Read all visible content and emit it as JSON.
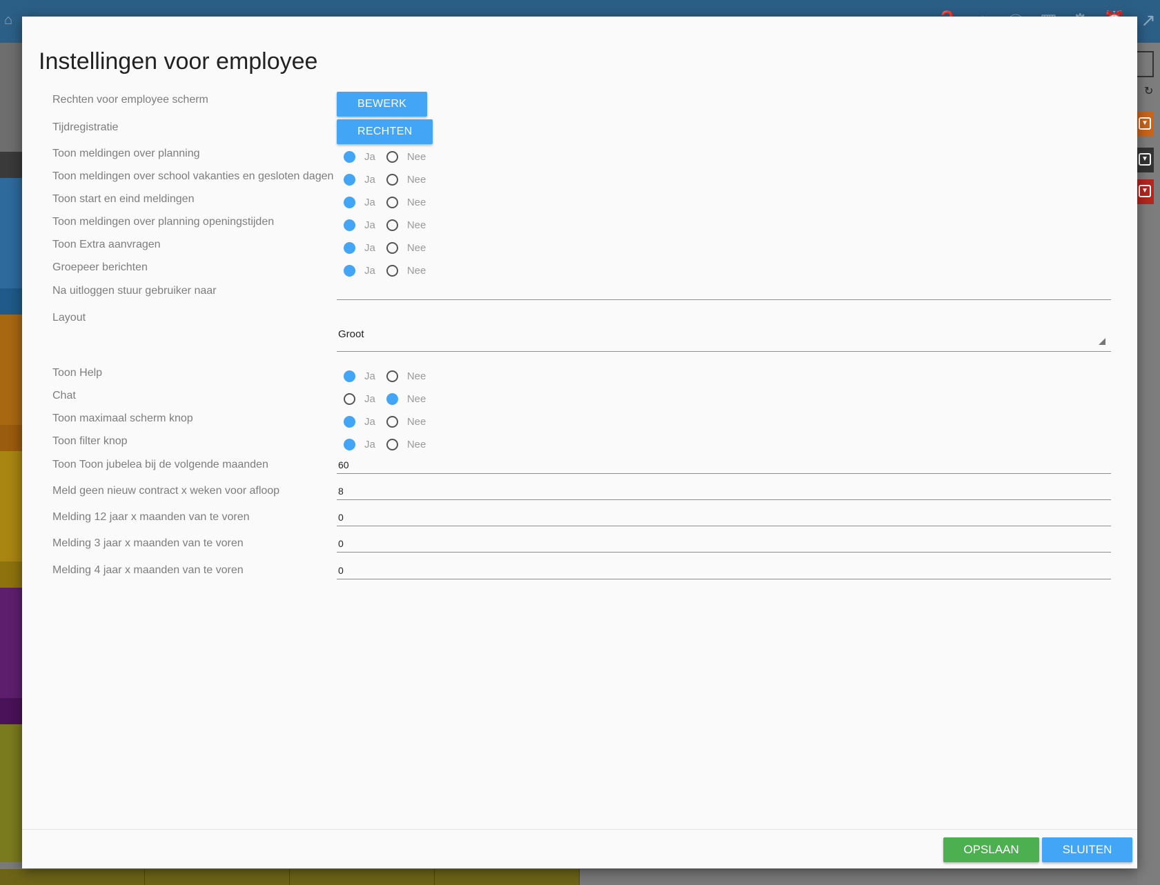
{
  "background": {
    "left_strip_colors": [
      "#6e6e6e",
      "#3a3a3a",
      "#2e6a9c",
      "#1f5a8a",
      "#a86812",
      "#9a5c0e",
      "#a98512",
      "#8e720e",
      "#5e1e6e",
      "#4a1258",
      "#7a7a1e"
    ],
    "right_tag_colors": [
      "#c8651a",
      "#333333",
      "#b4261e"
    ],
    "top_icons": [
      "home-icon",
      "help-icon",
      "school-icon",
      "info-icon",
      "grid-icon",
      "gear-icon",
      "alarm-icon",
      "external-link-icon"
    ]
  },
  "modal": {
    "title": "Instellingen voor employee",
    "rights_label": "Rechten voor employee scherm",
    "rights_button": "BEWERK",
    "time_label": "Tijdregistratie",
    "time_button": "RECHTEN",
    "yes_label": "Ja",
    "no_label": "Nee",
    "radio_rows_1": [
      {
        "label": "Toon meldingen over planning",
        "value": "Ja"
      },
      {
        "label": "Toon meldingen over school vakanties en gesloten dagen",
        "value": "Ja"
      },
      {
        "label": "Toon start en eind meldingen",
        "value": "Ja"
      },
      {
        "label": "Toon meldingen over planning openingstijden",
        "value": "Ja"
      },
      {
        "label": "Toon Extra aanvragen",
        "value": "Ja"
      },
      {
        "label": "Groepeer berichten",
        "value": "Ja"
      }
    ],
    "logout_label": "Na uitloggen stuur gebruiker naar",
    "logout_value": "",
    "layout_label": "Layout",
    "layout_value": "Groot",
    "radio_rows_2": [
      {
        "label": "Toon Help",
        "value": "Ja"
      },
      {
        "label": "Chat",
        "value": "Nee"
      },
      {
        "label": "Toon maximaal scherm knop",
        "value": "Ja"
      },
      {
        "label": "Toon filter knop",
        "value": "Ja"
      }
    ],
    "number_rows": [
      {
        "label": "Toon Toon jubelea bij de volgende maanden",
        "value": "60"
      },
      {
        "label": "Meld geen nieuw contract x weken voor afloop",
        "value": "8"
      },
      {
        "label": "Melding 12 jaar x maanden van te voren",
        "value": "0"
      },
      {
        "label": "Melding 3 jaar x maanden van te voren",
        "value": "0"
      },
      {
        "label": "Melding 4 jaar x maanden van te voren",
        "value": "0"
      }
    ],
    "save_button": "OPSLAAN",
    "close_button": "SLUITEN"
  }
}
